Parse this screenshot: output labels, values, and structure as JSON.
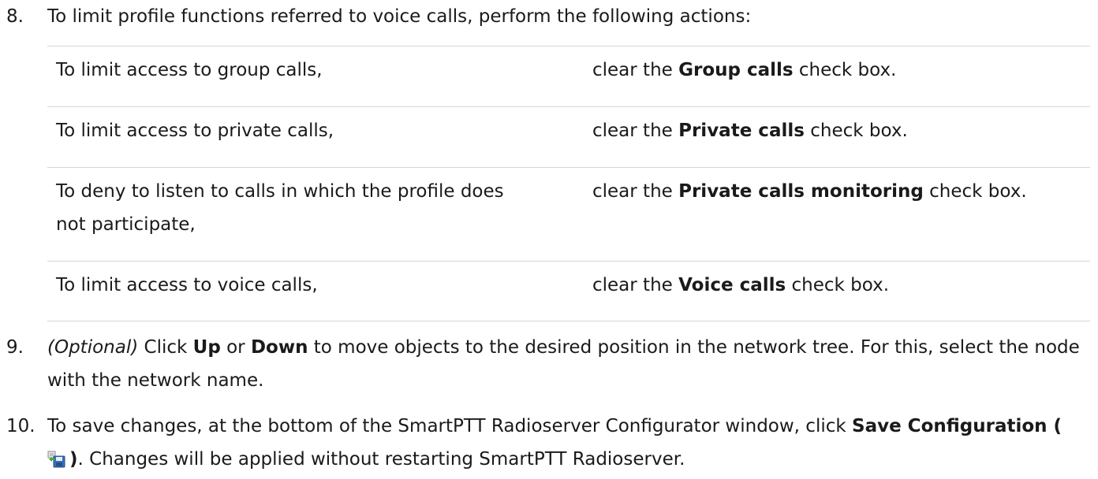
{
  "step8": {
    "number": "8.",
    "text": "To limit profile functions referred to voice calls, perform the following actions:",
    "rows": [
      {
        "condition": "To limit access to group calls,",
        "pre": "clear the ",
        "option": "Group calls",
        "post": " check box."
      },
      {
        "condition": "To limit access to private calls,",
        "pre": "clear the ",
        "option": "Private calls",
        "post": " check box."
      },
      {
        "condition": "To deny to listen to calls in which the profile does not participate,",
        "pre": "clear the ",
        "option": "Private calls monitoring",
        "post": " check box."
      },
      {
        "condition": "To limit access to voice calls,",
        "pre": "clear the ",
        "option": "Voice calls",
        "post": " check box."
      }
    ]
  },
  "step9": {
    "number": "9.",
    "optional": "(Optional)",
    "t1": " Click ",
    "up": "Up",
    "t2": " or ",
    "down": "Down",
    "t3": " to move objects to the desired position in the network tree. For this, select the node with the network name."
  },
  "step10": {
    "number": "10.",
    "t1": "To save changes, at the bottom of the SmartPTT Radioserver Configurator window, click ",
    "save_open": "Save Configuration (",
    "save_close": ")",
    "t2": ". Changes will be applied without restarting SmartPTT Radioserver.",
    "icon": "save-configuration-icon"
  }
}
